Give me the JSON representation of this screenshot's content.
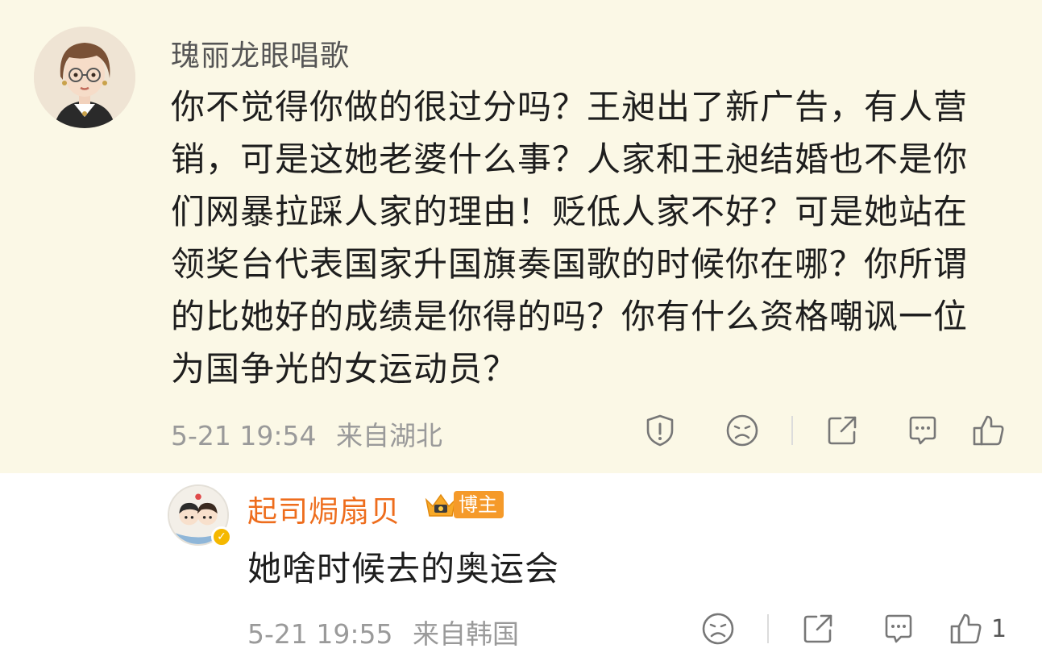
{
  "main_comment": {
    "username": "瑰丽龙眼唱歌",
    "content_lines": [
      "你不觉得你做的很过分吗？王昶出了新广告，有人营",
      "销，可是这她老婆什么事？人家和王昶结婚也不是你",
      "们网暴拉踩人家的理由！贬低人家不好？可是她站在",
      "领奖台代表国家升国旗奏国歌的时候你在哪？你所谓",
      "的比她好的成绩是你得的吗？你有什么资格嘲讽一位",
      "为国争光的女运动员？"
    ],
    "timestamp": "5-21 19:54",
    "location": "来自湖北",
    "actions": [
      "report-icon",
      "dislike-icon",
      "share-icon",
      "comment-icon",
      "like-icon"
    ]
  },
  "reply": {
    "username": "起司焗扇贝",
    "badge_label": "博主",
    "content": "她啥时候去的奥运会",
    "timestamp": "5-21 19:55",
    "location": "来自韩国",
    "like_count": "1",
    "actions": [
      "dislike-icon",
      "share-icon",
      "comment-icon",
      "like-icon"
    ]
  },
  "colors": {
    "highlight_bg": "#fbf8e6",
    "reply_username": "#ee6d1d",
    "badge_bg": "#f59a2a",
    "meta_text": "#9a9a9a"
  }
}
